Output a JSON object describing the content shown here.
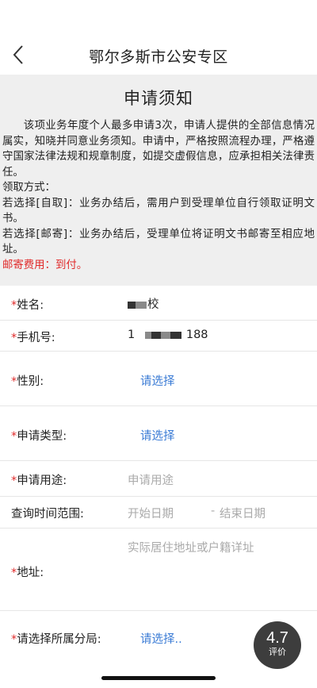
{
  "header": {
    "title": "鄂尔多斯市公安专区",
    "back_icon": "chevron-left-icon"
  },
  "notice": {
    "title": "申请须知",
    "paragraph": "该项业务年度个人最多申请3次，申请人提供的全部信息情况属实，知晓并同意业务须知。申请中，严格按照流程办理，严格遵守国家法律法规和规章制度，如提交虚假信息，应承担相关法律责任。",
    "pickup_heading": "领取方式：",
    "self_pickup": "若选择[自取]：业务办结后，需用户到受理单位自行领取证明文书。",
    "mail": "若选择[邮寄]：业务办结后，受理单位将证明文书邮寄至相应地址。",
    "postage": "邮寄费用：到付。",
    "postage_color": "#e02a2a"
  },
  "form": {
    "required_mark": "*",
    "name": {
      "label": "姓名:",
      "value_suffix": "校"
    },
    "phone": {
      "label": "手机号:",
      "value_prefix": "1",
      "value_suffix": "188"
    },
    "gender": {
      "label": "性别:",
      "value": "请选择"
    },
    "apply_type": {
      "label": "申请类型:",
      "value": "请选择"
    },
    "purpose": {
      "label": "申请用途:",
      "placeholder": "申请用途"
    },
    "time_range": {
      "label": "查询时间范围:",
      "start_placeholder": "开始日期",
      "separator": "-",
      "end_placeholder": "结束日期"
    },
    "address": {
      "label": "地址:",
      "placeholder": "实际居住地址或户籍详址"
    },
    "bureau": {
      "label": "请选择所属分局:",
      "value": "请选择.."
    }
  },
  "rating": {
    "score": "4.7",
    "label": "评价"
  },
  "colors": {
    "link": "#3a7bd5",
    "required": "#e02a2a",
    "notice_bg": "#efefef"
  }
}
